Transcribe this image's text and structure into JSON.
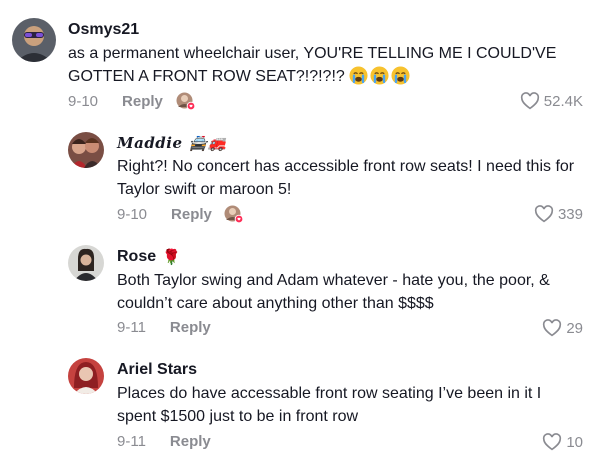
{
  "comments": [
    {
      "username": "Osmys21",
      "text_lines": [
        "as a permanent wheelchair user, YOU'RE TELLING ME I COULD'VE",
        "GOTTEN A FRONT ROW SEAT?!?!?!?"
      ],
      "emojis": [
        "loudly-crying-face-icon",
        "loudly-crying-face-icon",
        "loudly-crying-face-icon"
      ],
      "date": "9-10",
      "reply_label": "Reply",
      "likes": "52.4K",
      "creator_liked": true
    },
    {
      "username": "Maddie",
      "username_decoration": "🚔🚒",
      "text_lines": [
        "Right?! No concert has accessible front row seats! I need this for",
        "Taylor swift or maroon 5!"
      ],
      "date": "9-10",
      "reply_label": "Reply",
      "likes": "339",
      "creator_liked": true
    },
    {
      "username": "Rose",
      "username_decoration": "🌹",
      "text_lines": [
        "Both Taylor swing and Adam whatever - hate you, the poor, &",
        "couldn’t care about anything other than $$$$"
      ],
      "date": "9-11",
      "reply_label": "Reply",
      "likes": "29",
      "creator_liked": false
    },
    {
      "username": "Ariel Stars",
      "text_lines": [
        "Places do have accessable front row seating I’ve been in it I",
        "spent $1500 just to be in front row"
      ],
      "date": "9-11",
      "reply_label": "Reply",
      "likes": "10",
      "creator_liked": false
    }
  ],
  "colors": {
    "text": "#161823",
    "meta": "#8a8b91",
    "like_badge": "#fe2c55"
  }
}
